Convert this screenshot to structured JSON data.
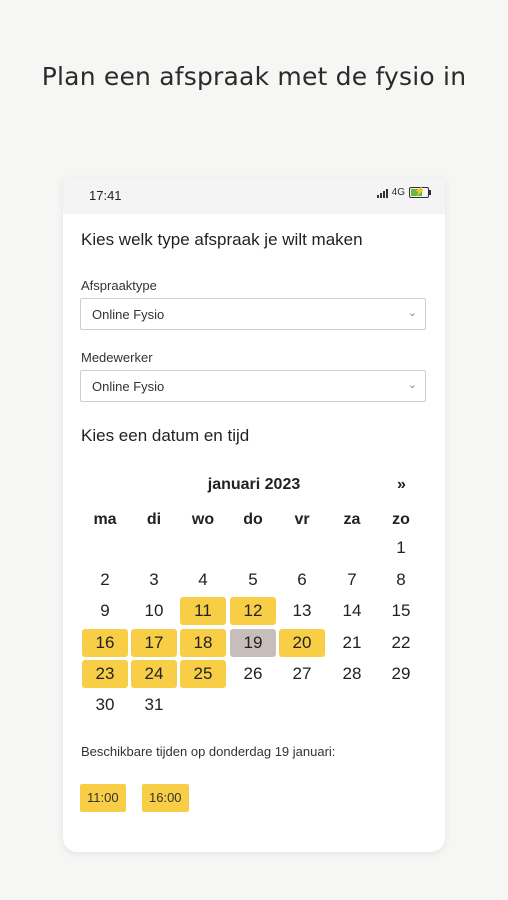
{
  "headline": "Plan een afspraak met de fysio in",
  "status": {
    "time": "17:41",
    "network": "4G"
  },
  "form": {
    "title": "Kies welk type afspraak je wilt maken",
    "type_label": "Afspraaktype",
    "type_value": "Online Fysio",
    "employee_label": "Medewerker",
    "employee_value": "Online Fysio"
  },
  "calendar": {
    "title": "Kies een datum en tijd",
    "month": "januari 2023",
    "next": "»",
    "weekdays": [
      "ma",
      "di",
      "wo",
      "do",
      "vr",
      "za",
      "zo"
    ],
    "days": [
      "1",
      "2",
      "3",
      "4",
      "5",
      "6",
      "7",
      "8",
      "9",
      "10",
      "11",
      "12",
      "13",
      "14",
      "15",
      "16",
      "17",
      "18",
      "19",
      "20",
      "21",
      "22",
      "23",
      "24",
      "25",
      "26",
      "27",
      "28",
      "29",
      "30",
      "31"
    ],
    "available": [
      11,
      12,
      16,
      17,
      18,
      20,
      23,
      24,
      25
    ],
    "selected": 19,
    "first_weekday_index": 6
  },
  "times": {
    "label": "Beschikbare tijden op donderdag 19 januari:",
    "slots": [
      "11:00",
      "16:00"
    ]
  },
  "colors": {
    "available": "#f7ce46",
    "selected": "#c7bdbb"
  },
  "icons": [
    "signal-icon",
    "battery-icon",
    "chevron-down-icon"
  ]
}
